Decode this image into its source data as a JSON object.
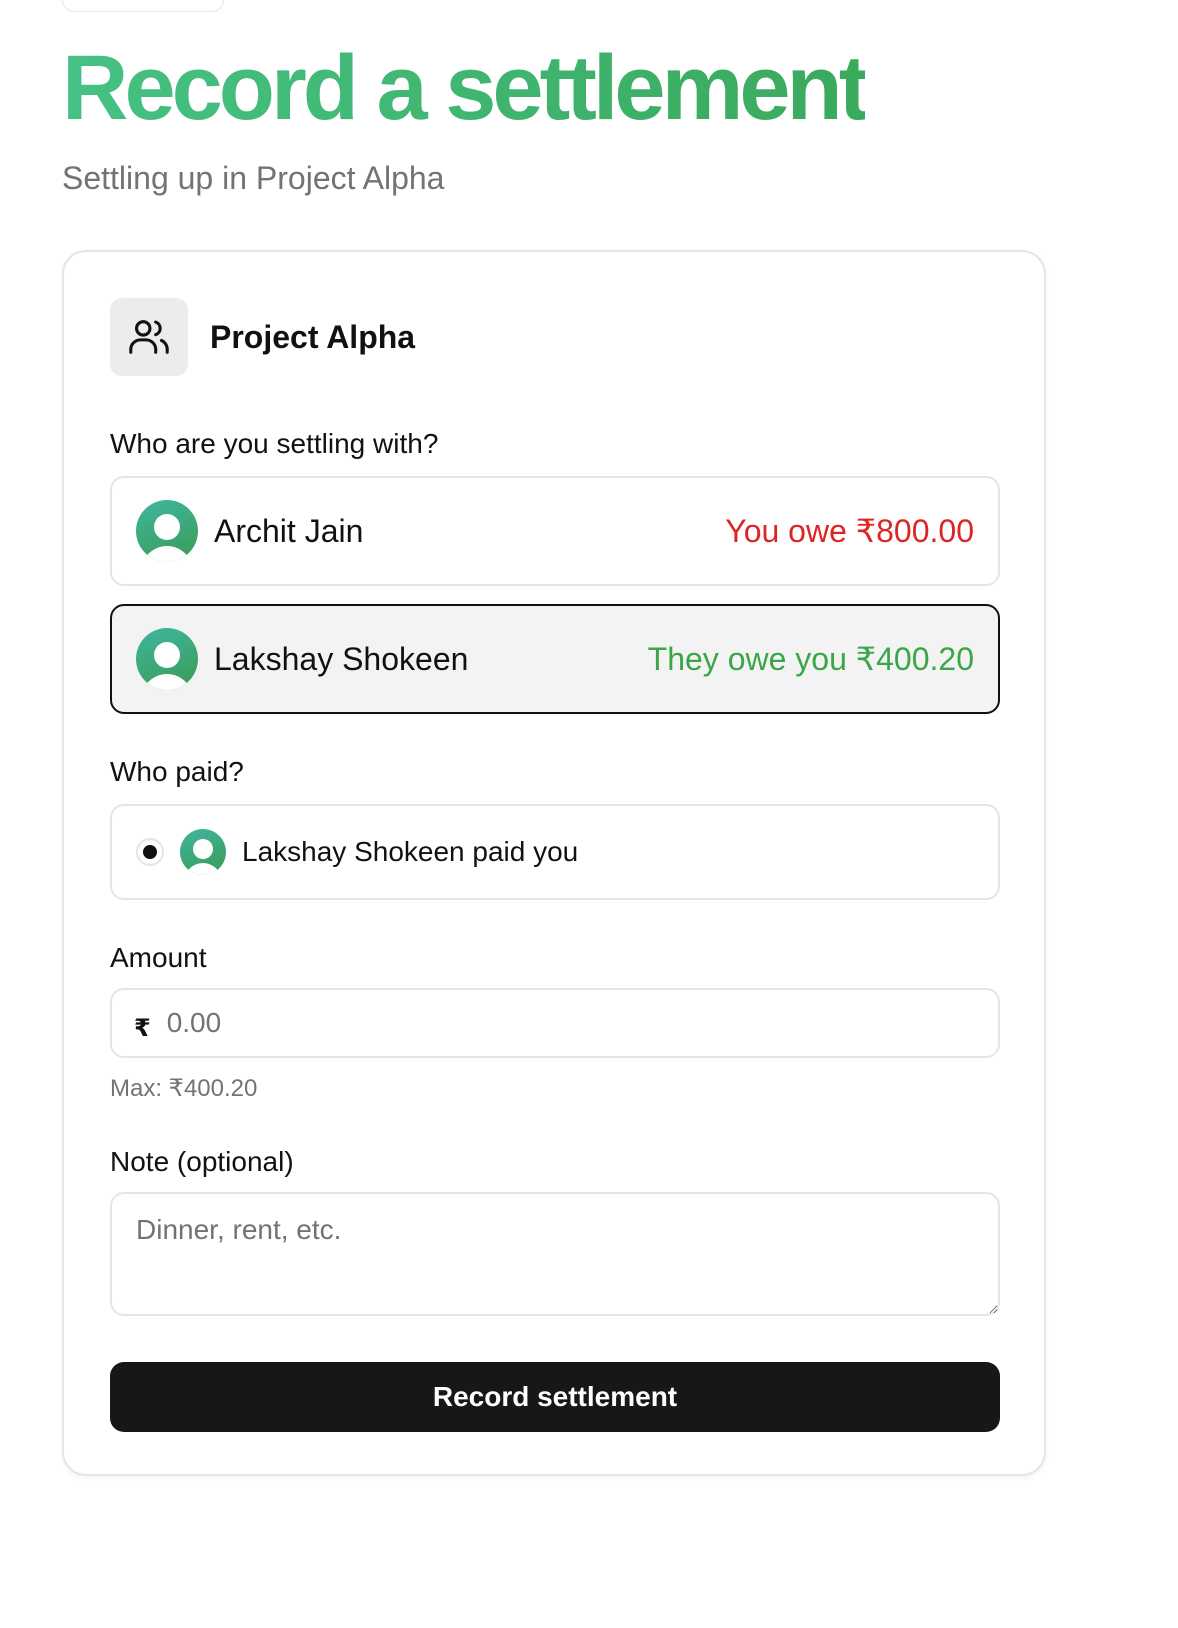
{
  "page": {
    "title": "Record a settlement",
    "subtitle": "Settling up in Project Alpha"
  },
  "group": {
    "name": "Project Alpha",
    "icon": "users-icon"
  },
  "settle_with": {
    "label": "Who are you settling with?",
    "options": [
      {
        "name": "Archit Jain",
        "balance_text": "You owe ₹800.00",
        "balance_color": "#dc2626",
        "selected": false
      },
      {
        "name": "Lakshay Shokeen",
        "balance_text": "They owe you ₹400.20",
        "balance_color": "#3aa648",
        "selected": true
      }
    ]
  },
  "who_paid": {
    "label": "Who paid?",
    "option_text": "Lakshay Shokeen paid you",
    "selected": true
  },
  "amount": {
    "label": "Amount",
    "currency_symbol": "₹",
    "placeholder": "0.00",
    "max_hint": "Max: ₹400.20"
  },
  "note": {
    "label": "Note (optional)",
    "placeholder": "Dinner, rent, etc."
  },
  "submit": {
    "label": "Record settlement"
  },
  "colors": {
    "title_gradient_start": "#46c184",
    "title_gradient_end": "#3aaa5c",
    "owe_red": "#dc2626",
    "owed_green": "#3aa648",
    "button_bg": "#171717"
  }
}
